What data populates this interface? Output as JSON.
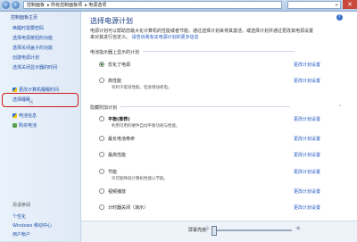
{
  "address": {
    "segments": [
      "控制面板",
      "所有控制面板项",
      "电源选项"
    ]
  },
  "sidebar": {
    "home": "控制面板主页",
    "links": [
      {
        "label": "唤醒时需要密码",
        "icon": ""
      },
      {
        "label": "选择电源按钮的功能",
        "icon": ""
      },
      {
        "label": "选择关闭盖子的功能",
        "icon": ""
      },
      {
        "label": "创建电源计划",
        "icon": ""
      },
      {
        "label": "选择关闭显示器的时间",
        "icon": ""
      },
      {
        "label": "更改计算机睡眠时间",
        "icon": "shield-icon"
      },
      {
        "label": "选择睡眠",
        "icon": ""
      },
      {
        "label": "电池信息",
        "icon": "shield-icon"
      },
      {
        "label": "购买电池",
        "icon": "globe-icon"
      }
    ],
    "see_also": "另请参阅",
    "see_links": [
      "个性化",
      "Windows 移动中心",
      "用户帐户"
    ]
  },
  "main": {
    "title": "选择电源计划",
    "desc_line1": "电源计划可以帮助您最大化计算机的性能或者节能。通过选择计划来将其激活，或选择计划并通过更改其电源设置",
    "desc_line2": "来对其进行自定义。",
    "desc_link": "请告诉我有关电源计划的更多信息",
    "section1": "电池指示器上显示的计划",
    "section2": "隐藏附加计划",
    "change_label": "更改计划设置",
    "plans_shown": [
      {
        "name": "优化了电源",
        "sub": "",
        "selected": true
      },
      {
        "name": "高性能",
        "sub": "有利于提高性能，但会增加耗电。",
        "selected": false
      }
    ],
    "plans_hidden": [
      {
        "name": "平衡(推荐)",
        "sub": "利用可用的硬件自动平衡功耗与性能。"
      },
      {
        "name": "最长电池寿命",
        "sub": ""
      },
      {
        "name": "最高性能",
        "sub": ""
      },
      {
        "name": "节能",
        "sub": "尽可能降低计算机性能以节能。"
      },
      {
        "name": "视频播放",
        "sub": ""
      },
      {
        "name": "计时器关闭（演示）",
        "sub": ""
      }
    ]
  },
  "status": {
    "brightness_label": "屏幕亮度:",
    "brightness": 0.0
  },
  "colors": {
    "accent": "#1f56c2",
    "highlight": "#d01a1a"
  }
}
